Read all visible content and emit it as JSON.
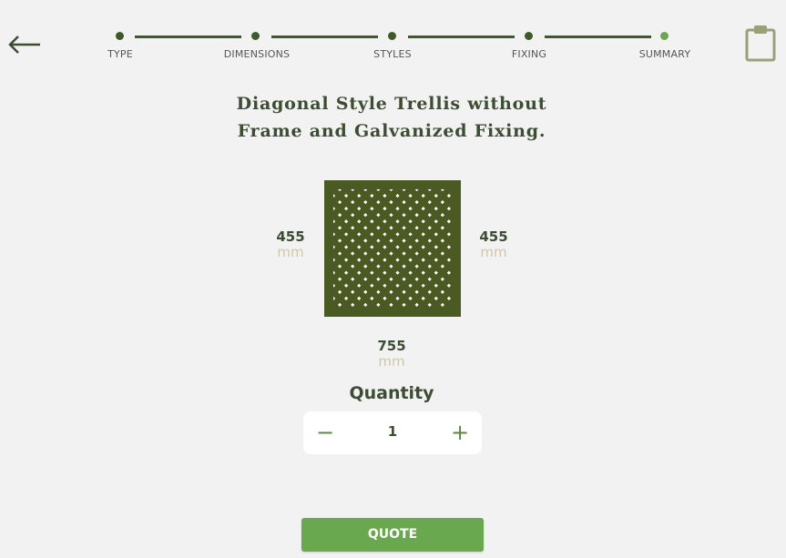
{
  "header": {
    "back_icon": "arrow-left-icon",
    "clipboard_icon": "clipboard-icon"
  },
  "steps": [
    {
      "label": "TYPE",
      "active": false
    },
    {
      "label": "DIMENSIONS",
      "active": false
    },
    {
      "label": "STYLES",
      "active": false
    },
    {
      "label": "FIXING",
      "active": false
    },
    {
      "label": "SUMMARY",
      "active": true
    }
  ],
  "summary": {
    "title_line1": "Diagonal Style Trellis without",
    "title_line2": "Frame and Galvanized Fixing."
  },
  "dimensions": {
    "left_value": "455",
    "left_unit": "mm",
    "right_value": "455",
    "right_unit": "mm",
    "bottom_value": "755",
    "bottom_unit": "mm"
  },
  "quantity": {
    "label": "Quantity",
    "value": "1",
    "decrement": "−",
    "increment": "+"
  },
  "actions": {
    "quote_label": "QUOTE"
  },
  "colors": {
    "primary_dark": "#3f5a2a",
    "accent": "#6aa84f",
    "trellis": "#4a5a22",
    "unit": "#d1c7a8"
  }
}
